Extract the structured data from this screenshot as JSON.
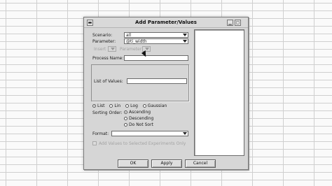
{
  "dialog": {
    "title": "Add Parameter/Values",
    "system_menu_glyph": "▬",
    "minimize_glyph": "▁",
    "maximize_glyph": "▢"
  },
  "form": {
    "scenario_label": "Scenario:",
    "scenario_value": "all",
    "parameter_label": "Parameter:",
    "parameter_value": "@ti_width",
    "insert_label": "Insert",
    "parameter_small_label": "Parameter",
    "process_name_label": "Process Name:",
    "process_name_value": "",
    "list_of_values_label": "List of Values:",
    "list_of_values_value": "",
    "distribution_options": [
      {
        "label": "List",
        "checked": true
      },
      {
        "label": "Lin",
        "checked": false
      },
      {
        "label": "Log",
        "checked": false
      },
      {
        "label": "Gaussian",
        "checked": false
      }
    ],
    "sorting_order_label": "Sorting Order:",
    "sorting_options": [
      {
        "label": "Ascending",
        "checked": true
      },
      {
        "label": "Descending",
        "checked": false
      },
      {
        "label": "Do Not Sort",
        "checked": false
      }
    ],
    "format_label": "Format:",
    "format_value": "",
    "add_values_label": "Add Values to Selected Experiments Only",
    "add_values_checked": false
  },
  "buttons": {
    "ok": "OK",
    "apply": "Apply",
    "cancel": "Cancel"
  },
  "icons": {
    "combo_arrow": "chevron-down-icon",
    "mouse_pointer": "cursor-icon"
  },
  "colors": {
    "dialog_bg": "#d6d6d6",
    "grid_line": "#cfcfcf",
    "disabled_text": "#a3a3a3"
  }
}
